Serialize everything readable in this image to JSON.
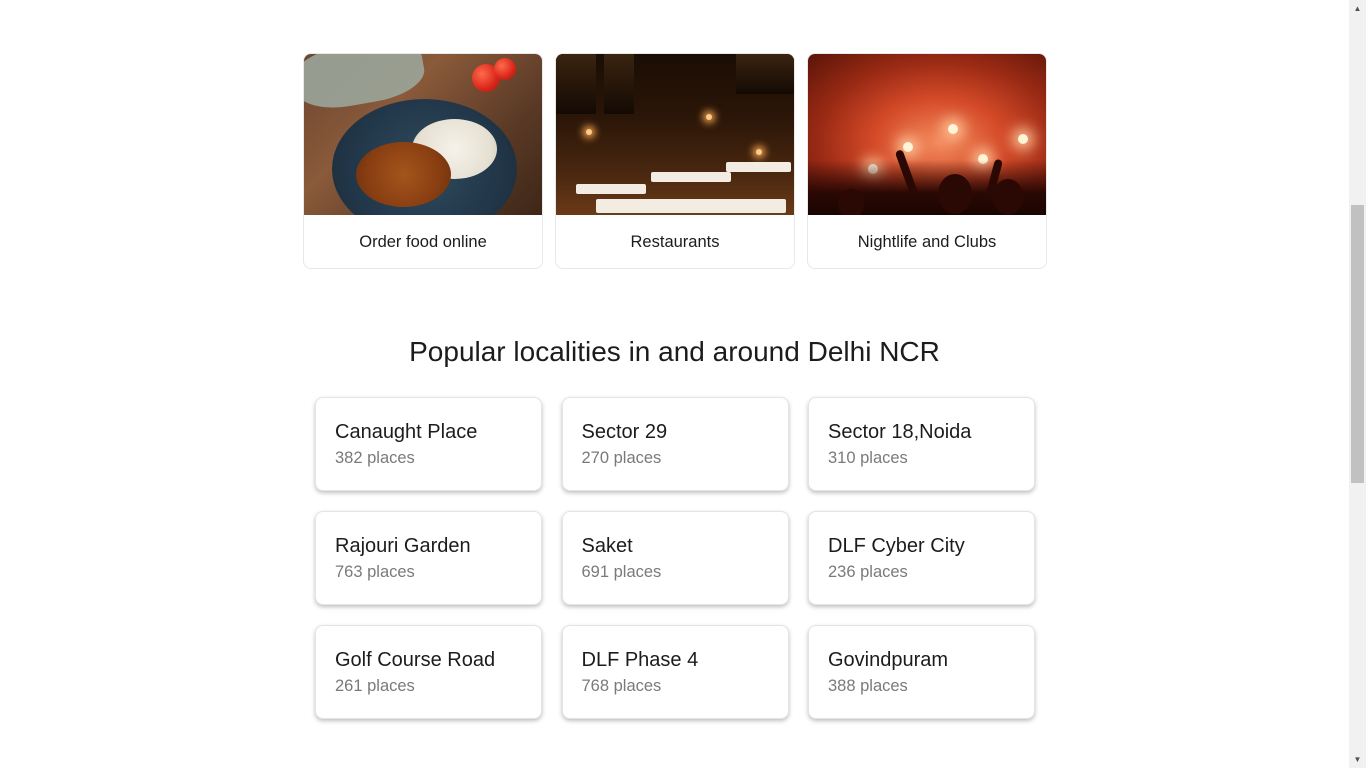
{
  "categories": [
    {
      "label": "Order food online",
      "image": "food-plate-image"
    },
    {
      "label": "Restaurants",
      "image": "restaurant-interior-image"
    },
    {
      "label": "Nightlife and Clubs",
      "image": "nightclub-crowd-image"
    }
  ],
  "localities_section": {
    "title": "Popular localities in and around Delhi NCR"
  },
  "localities": [
    {
      "name": "Canaught Place",
      "count": "382 places"
    },
    {
      "name": "Sector 29",
      "count": "270 places"
    },
    {
      "name": "Sector 18,Noida",
      "count": "310 places"
    },
    {
      "name": "Rajouri Garden",
      "count": "763 places"
    },
    {
      "name": "Saket",
      "count": "691 places"
    },
    {
      "name": "DLF Cyber City",
      "count": "236 places"
    },
    {
      "name": "Golf Course Road",
      "count": "261 places"
    },
    {
      "name": "DLF Phase 4",
      "count": "768 places"
    },
    {
      "name": "Govindpuram",
      "count": "388 places"
    }
  ],
  "scrollbar": {
    "up_icon": "scroll-up-arrow-icon",
    "down_icon": "scroll-down-arrow-icon"
  },
  "colors": {
    "text": "#1c1c1c",
    "muted": "#7a7a7a",
    "card_border": "#e4e4e4"
  }
}
